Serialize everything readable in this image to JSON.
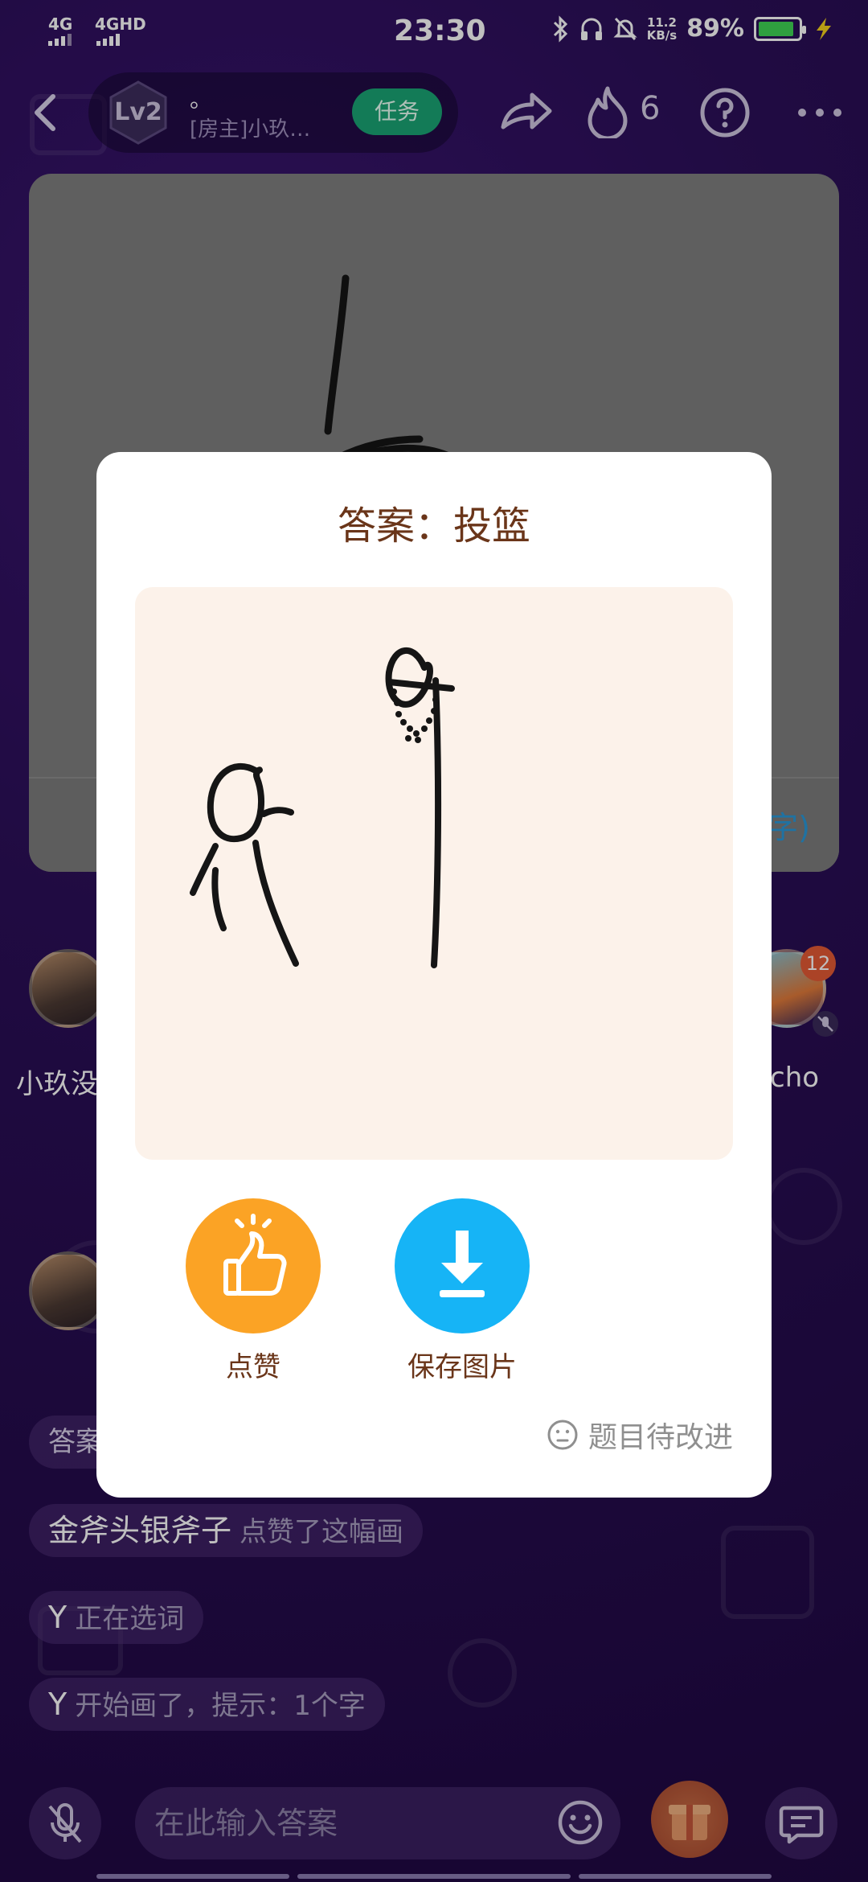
{
  "status_bar": {
    "network1": "4G",
    "network2": "4GHD",
    "time": "23:30",
    "speed_value": "11.2",
    "speed_unit": "KB/s",
    "battery": "89%",
    "battery_level": 0.89
  },
  "header": {
    "level_badge": "Lv2",
    "room_name": "。",
    "room_owner": "[房主]小玖…",
    "task_button": "任务",
    "fire_count": "6"
  },
  "canvas": {
    "hint_suffix": "字)"
  },
  "players": {
    "left_name": "小玖没",
    "right_name": "cho",
    "right_badge": "12"
  },
  "chat": {
    "answer_partial": "答案",
    "like_user": "金斧头银斧子",
    "like_action": "点赞了这幅画",
    "choosing_user": "Y",
    "choosing_action": "正在选词",
    "start_user": "Y",
    "start_action": "开始画了，提示：1个字"
  },
  "input": {
    "placeholder": "在此输入答案"
  },
  "modal": {
    "title": "答案：投篮",
    "like_label": "点赞",
    "save_label": "保存图片",
    "feedback_label": "题目待改进"
  },
  "colors": {
    "background": "#2b0f58",
    "task_green": "#1aa575",
    "like_orange": "#fba325",
    "save_blue": "#16b4f6",
    "title_brown": "#6a3519",
    "drawing_bg": "#fcf2ea"
  }
}
